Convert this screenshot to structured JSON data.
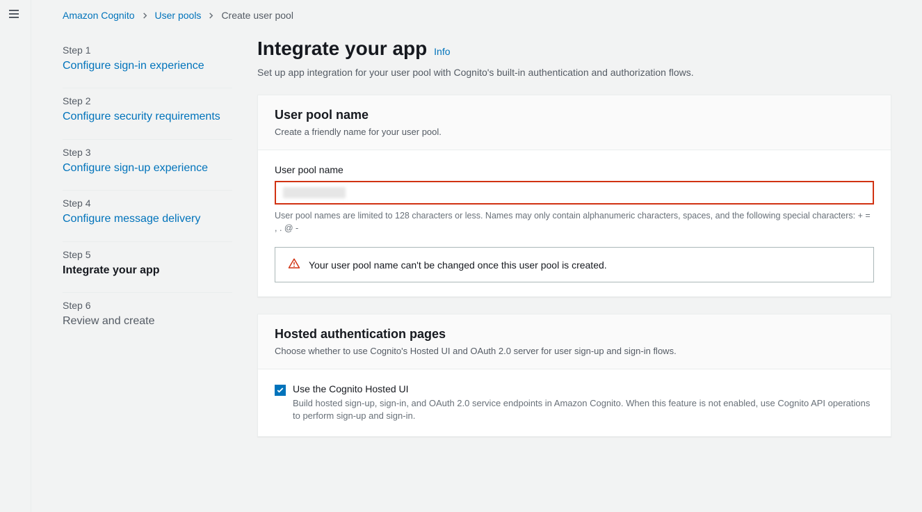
{
  "breadcrumb": {
    "items": [
      {
        "label": "Amazon Cognito",
        "link": true
      },
      {
        "label": "User pools",
        "link": true
      },
      {
        "label": "Create user pool",
        "link": false
      }
    ]
  },
  "steps": [
    {
      "num": "Step 1",
      "title": "Configure sign-in experience",
      "state": "done"
    },
    {
      "num": "Step 2",
      "title": "Configure security requirements",
      "state": "done"
    },
    {
      "num": "Step 3",
      "title": "Configure sign-up experience",
      "state": "done"
    },
    {
      "num": "Step 4",
      "title": "Configure message delivery",
      "state": "done"
    },
    {
      "num": "Step 5",
      "title": "Integrate your app",
      "state": "active"
    },
    {
      "num": "Step 6",
      "title": "Review and create",
      "state": "future"
    }
  ],
  "header": {
    "title": "Integrate your app",
    "info": "Info",
    "subtitle": "Set up app integration for your user pool with Cognito's built-in authentication and authorization flows."
  },
  "pool_name_panel": {
    "heading": "User pool name",
    "desc": "Create a friendly name for your user pool.",
    "field_label": "User pool name",
    "value": "",
    "hint": "User pool names are limited to 128 characters or less. Names may only contain alphanumeric characters, spaces, and the following special characters: + = , . @ -",
    "warning": "Your user pool name can't be changed once this user pool is created."
  },
  "hosted_panel": {
    "heading": "Hosted authentication pages",
    "desc": "Choose whether to use Cognito's Hosted UI and OAuth 2.0 server for user sign-up and sign-in flows.",
    "checkbox_label": "Use the Cognito Hosted UI",
    "checkbox_desc": "Build hosted sign-up, sign-in, and OAuth 2.0 service endpoints in Amazon Cognito. When this feature is not enabled, use Cognito API operations to perform sign-up and sign-in.",
    "checked": true
  }
}
